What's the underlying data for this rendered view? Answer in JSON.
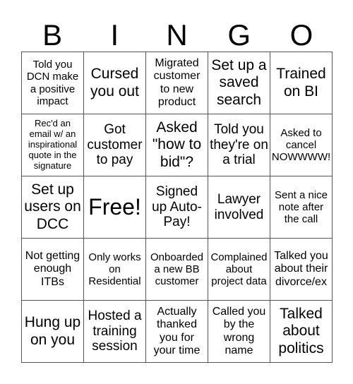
{
  "header": {
    "letters": [
      "B",
      "I",
      "N",
      "G",
      "O"
    ]
  },
  "grid": {
    "rows": [
      [
        "Told you DCN make a positive impact",
        "Cursed you out",
        "Migrated customer to new product",
        "Set up a saved search",
        "Trained on BI"
      ],
      [
        "Rec'd an email w/ an inspirational quote in the signature",
        "Got customer to pay",
        "Asked \"how to bid\"?",
        "Told you they're on a trial",
        "Asked to cancel NOWWWW!"
      ],
      [
        "Set up users on DCC",
        "Free!",
        "Signed up Auto-Pay!",
        "Lawyer involved",
        "Sent a nice note after the call"
      ],
      [
        "Not getting enough ITBs",
        "Only works on Residential",
        "Onboarded a new BB customer",
        "Complained about project data",
        "Talked you about their divorce/ex"
      ],
      [
        "Hung up on you",
        "Hosted a training session",
        "Actually thanked you for your time",
        "Called you by the wrong name",
        "Talked about politics"
      ]
    ]
  }
}
